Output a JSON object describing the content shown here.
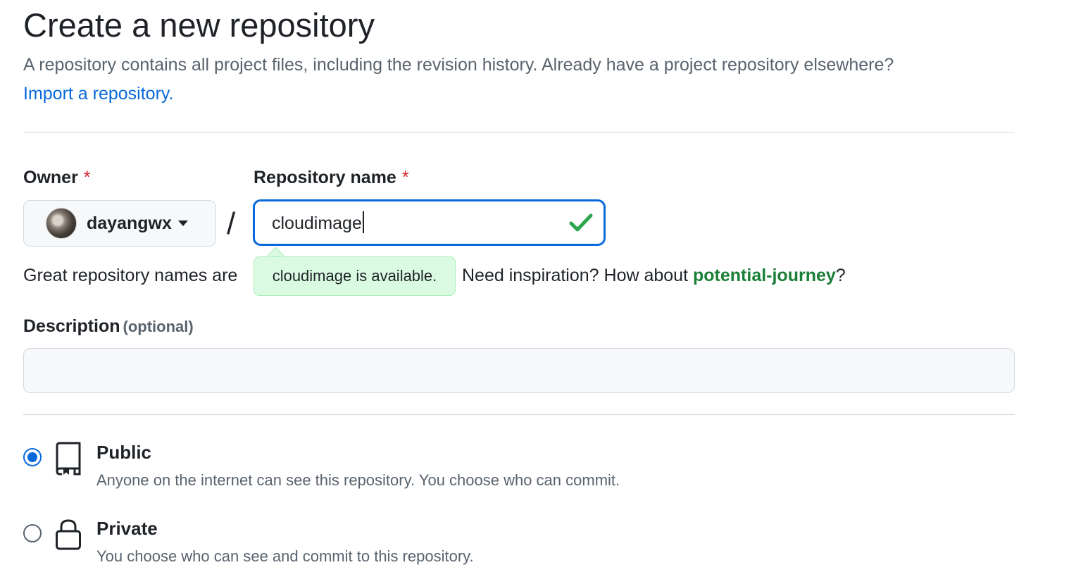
{
  "header": {
    "title": "Create a new repository",
    "intro": "A repository contains all project files, including the revision history. Already have a project repository elsewhere?",
    "import_link": "Import a repository."
  },
  "owner": {
    "label": "Owner",
    "required_mark": "*",
    "selected": "dayangwx",
    "avatar_icon": "user-avatar"
  },
  "separator": "/",
  "repo_name": {
    "label": "Repository name",
    "required_mark": "*",
    "value": "cloudimage",
    "status_icon": "check-icon",
    "tooltip": "cloudimage is available."
  },
  "hint": {
    "prefix": "Great repository names are",
    "question": "Need inspiration? How about",
    "suggestion": "potential-journey",
    "suffix": "?"
  },
  "description": {
    "label": "Description",
    "optional": "(optional)",
    "value": ""
  },
  "visibility": {
    "selected": "public",
    "options": [
      {
        "title": "Public",
        "desc": "Anyone on the internet can see this repository. You choose who can commit.",
        "icon": "repo-icon"
      },
      {
        "title": "Private",
        "desc": "You choose who can see and commit to this repository.",
        "icon": "lock-icon"
      }
    ]
  },
  "colors": {
    "link": "#0969da",
    "success": "#1a7f37",
    "check": "#2da44e",
    "required": "#d1242f",
    "tooltip_bg": "#dafbe1"
  }
}
